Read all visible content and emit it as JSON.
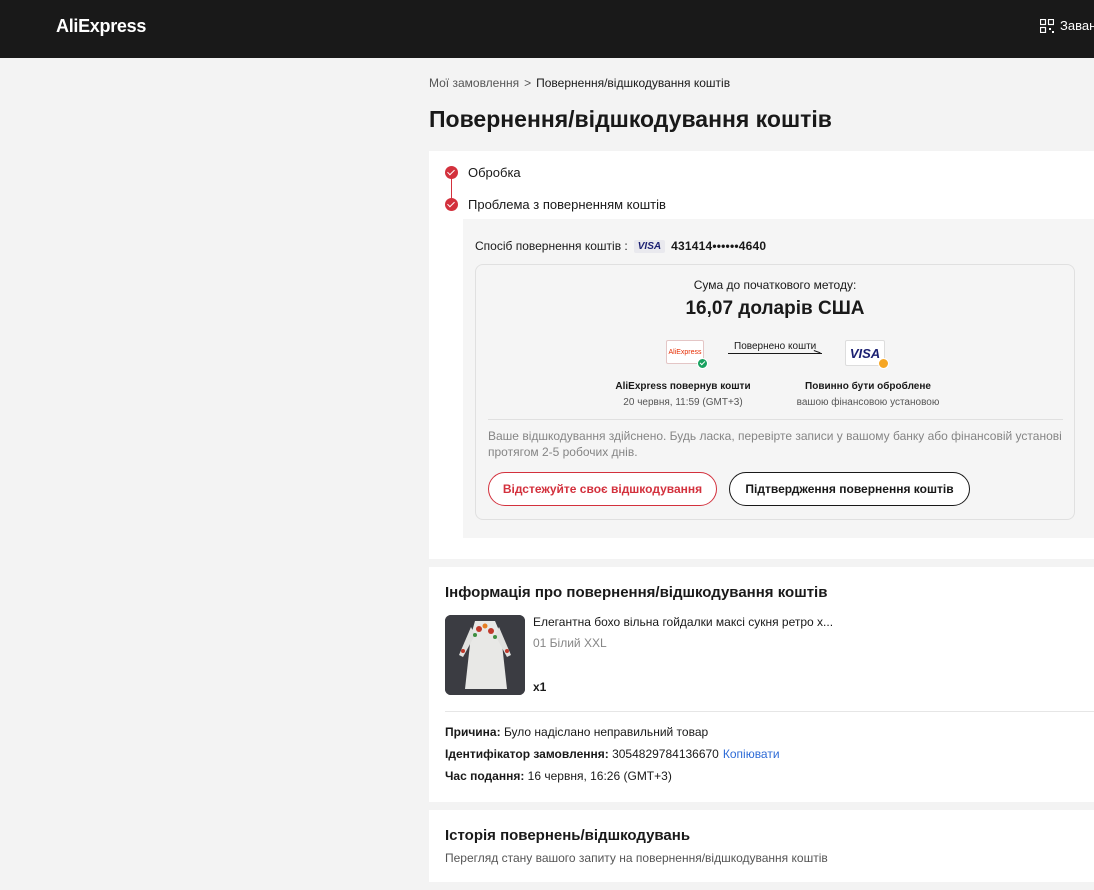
{
  "header": {
    "logo": "AliExpress",
    "download_label": "Завант"
  },
  "breadcrumb": {
    "parent": "Мої замовлення",
    "separator": ">",
    "current": "Повернення/відшкодування коштів"
  },
  "page_title": "Повернення/відшкодування коштів",
  "status": {
    "steps": [
      {
        "label": "Обробка"
      },
      {
        "label": "Проблема з поверненням коштів"
      }
    ],
    "method_label": "Спосіб повернення коштів :",
    "method_brand": "VISA",
    "card_number": "431414••••••4640",
    "sum_label": "Сума до початкового методу:",
    "sum_value": "16,07 доларів США",
    "flow_label": "Повернено кошти",
    "source_logo": "AliExpress",
    "source_title": "AliExpress повернув кошти",
    "source_time": "20 червня, 11:59 (GMT+3)",
    "dest_logo": "VISA",
    "dest_title": "Повинно бути оброблене",
    "dest_sub": "вашою фінансовою установою",
    "note": "Ваше відшкодування здійснено. Будь ласка, перевірте записи у вашому банку або фінансовій установі протягом 2-5 робочих днів.",
    "track_button": "Відстежуйте своє відшкодування",
    "confirm_button": "Підтвердження повернення коштів",
    "colors": {
      "accent": "#d3313d",
      "ok": "#18a15f",
      "pending": "#f6a623"
    }
  },
  "refund_info": {
    "title": "Інформація про повернення/відшкодування коштів",
    "item_name": "Елегантна бохо вільна гойдалки максі сукня ретро х...",
    "item_variant": "01 Білий XXL",
    "item_qty": "x1",
    "reason_label": "Причина:",
    "reason_value": "Було надіслано неправильний товар",
    "order_label": "Ідентифікатор замовлення:",
    "order_value": "3054829784136670",
    "copy_link": "Копіювати",
    "time_label": "Час подання:",
    "time_value": "16 червня, 16:26 (GMT+3)"
  },
  "history": {
    "title": "Історія повернень/відшкодувань",
    "subtitle": "Перегляд стану вашого запиту на повернення/відшкодування коштів"
  }
}
